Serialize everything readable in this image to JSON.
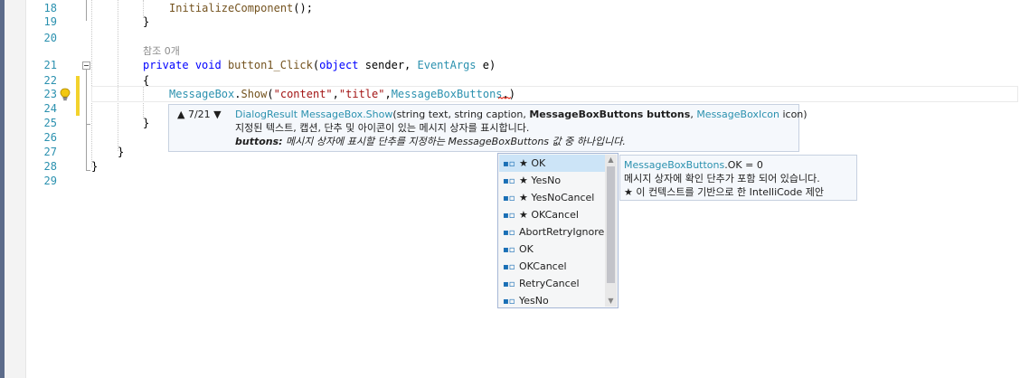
{
  "editor": {
    "lines": [
      {
        "num": "18"
      },
      {
        "num": "19"
      },
      {
        "num": "20"
      },
      {
        "num": "21"
      },
      {
        "num": "22"
      },
      {
        "num": "23"
      },
      {
        "num": "24"
      },
      {
        "num": "25"
      },
      {
        "num": "26"
      },
      {
        "num": "27"
      },
      {
        "num": "28"
      },
      {
        "num": "29"
      }
    ],
    "code": {
      "l18_method": "InitializeComponent",
      "l18_rest": "();",
      "l19": "}",
      "codelens": "참조 0개",
      "l21_private": "private",
      "l21_void": "void",
      "l21_name": "button1_Click",
      "l21_open": "(",
      "l21_object": "object",
      "l21_sender": " sender, ",
      "l21_eventargs": "EventArgs",
      "l21_e": " e)",
      "l22": "{",
      "l23_class": "MessageBox",
      "l23_dot": ".",
      "l23_show": "Show",
      "l23_open": "(",
      "l23_s1": "\"content\"",
      "l23_comma1": ",",
      "l23_s2": "\"title\"",
      "l23_comma2": ",",
      "l23_enum": "MessageBoxButtons",
      "l23_dot2": ".",
      "l23_close": ")",
      "l25": "}",
      "l27": "}",
      "l28": "}"
    }
  },
  "param_tip": {
    "nav_counter": "7/21",
    "up_arrow": "▲",
    "down_arrow": "▼",
    "sig_return": "DialogResult",
    "sig_class_method": "MessageBox.Show",
    "sig_params_pre": "(string text, string caption, ",
    "sig_current_param": "MessageBoxButtons buttons",
    "sig_params_post_a": ", ",
    "sig_icon_type": "MessageBoxIcon",
    "sig_params_post_b": " icon)",
    "description": "지정된 텍스트, 캡션, 단추 및 아이콘이 있는 메시지 상자를 표시합니다.",
    "param_name": "buttons:",
    "param_description": " 메시지 상자에 표시할 단추를 지정하는 MessageBoxButtons 값 중 하나입니다."
  },
  "completion": {
    "items": [
      {
        "label": "★ OK"
      },
      {
        "label": "★ YesNo"
      },
      {
        "label": "★ YesNoCancel"
      },
      {
        "label": "★ OKCancel"
      },
      {
        "label": "AbortRetryIgnore"
      },
      {
        "label": "OK"
      },
      {
        "label": "OKCancel"
      },
      {
        "label": "RetryCancel"
      },
      {
        "label": "YesNo"
      }
    ],
    "item_icon": "enum-member-icon",
    "scroll_up_icon": "▲",
    "scroll_down_icon": "▼"
  },
  "desc_tip": {
    "line1_type": "MessageBoxButtons",
    "line1_rest": ".OK = 0",
    "line2": "메시지 상자에 확인 단추가 포함 되어 있습니다.",
    "line3": "★  이 컨텍스트를 기반으로 한 IntelliCode 제안"
  },
  "colors": {
    "keyword": "#0000ff",
    "type": "#2b91af",
    "string": "#a31515",
    "line_number": "#2b91af",
    "selection": "#cce4f7",
    "change_marker": "#f3d22c"
  }
}
